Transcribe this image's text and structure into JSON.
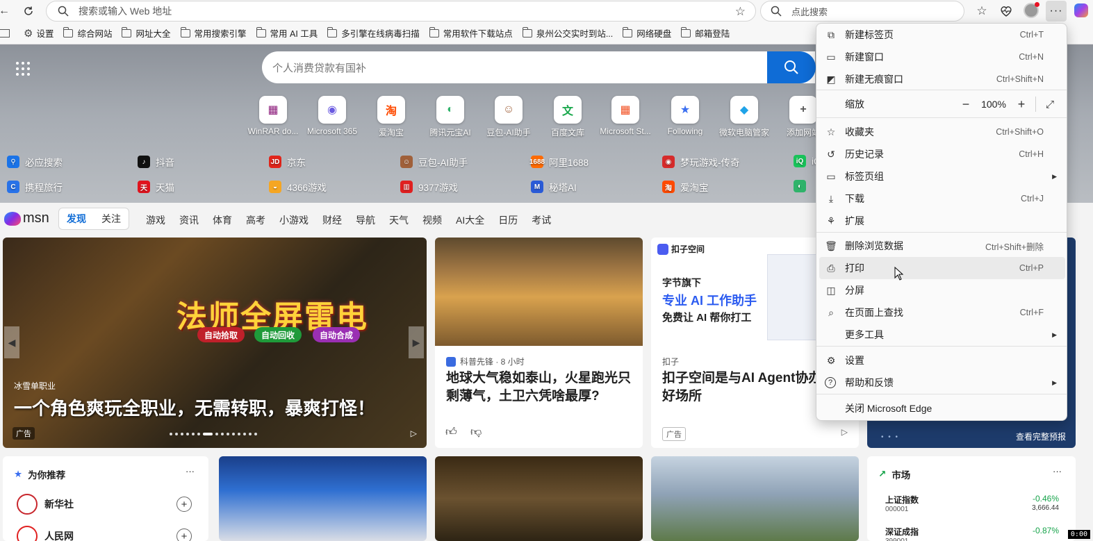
{
  "toolbar": {
    "address_placeholder": "搜索或输入 Web 地址",
    "search_placeholder": "点此搜索",
    "more_label": "···"
  },
  "favorites": [
    {
      "label": "设置",
      "icon": "gear-icon"
    },
    {
      "label": "综合网站",
      "icon": "folder-icon"
    },
    {
      "label": "网址大全",
      "icon": "folder-icon"
    },
    {
      "label": "常用搜索引擎",
      "icon": "folder-icon"
    },
    {
      "label": "常用 AI 工具",
      "icon": "folder-icon"
    },
    {
      "label": "多引擎在线病毒扫描",
      "icon": "folder-icon"
    },
    {
      "label": "常用软件下载站点",
      "icon": "folder-icon"
    },
    {
      "label": "泉州公交实时到站...",
      "icon": "folder-icon"
    },
    {
      "label": "网络硬盘",
      "icon": "folder-icon"
    },
    {
      "label": "邮箱登陆",
      "icon": "folder-icon"
    }
  ],
  "hero": {
    "search_placeholder": "个人消费贷款有国补",
    "tiles": [
      {
        "label": "WinRAR do...",
        "glyph": "▦",
        "color": "#8b1a7a"
      },
      {
        "label": "Microsoft 365",
        "glyph": "◉",
        "color": "#6a5ae0"
      },
      {
        "label": "爱淘宝",
        "glyph": "淘",
        "color": "#ff4a00"
      },
      {
        "label": "腾讯元宝AI",
        "glyph": "◐",
        "color": "#2fb36a"
      },
      {
        "label": "豆包-AI助手",
        "glyph": "☺",
        "color": "#a0603a"
      },
      {
        "label": "百度文库",
        "glyph": "文",
        "color": "#19a84c"
      },
      {
        "label": "Microsoft St...",
        "glyph": "▦",
        "color": "#f25022"
      },
      {
        "label": "Following",
        "glyph": "★",
        "color": "#3b6ff0"
      },
      {
        "label": "微软电脑管家",
        "glyph": "◆",
        "color": "#1fa3e8"
      },
      {
        "label": "添加网站",
        "glyph": "+",
        "color": "#555555"
      }
    ],
    "quick_links_row1": [
      {
        "label": "必应搜索",
        "glyph": "⚲",
        "color": "#1a73e8"
      },
      {
        "label": "抖音",
        "glyph": "♪",
        "color": "#111111"
      },
      {
        "label": "京东",
        "glyph": "JD",
        "color": "#e1251b"
      },
      {
        "label": "豆包-AI助手",
        "glyph": "☺",
        "color": "#a0603a"
      },
      {
        "label": "阿里1688",
        "glyph": "1688",
        "color": "#ff6a00"
      },
      {
        "label": "梦玩游戏-传奇",
        "glyph": "◉",
        "color": "#d62b2b"
      },
      {
        "label": "iQIYI",
        "glyph": "iQ",
        "color": "#19c35a"
      }
    ],
    "quick_links_row2": [
      {
        "label": "携程旅行",
        "glyph": "C",
        "color": "#2872e8"
      },
      {
        "label": "天猫",
        "glyph": "天",
        "color": "#e0141e"
      },
      {
        "label": "4366游戏",
        "glyph": "◒",
        "color": "#f5a623"
      },
      {
        "label": "9377游戏",
        "glyph": "▥",
        "color": "#e02020"
      },
      {
        "label": "秘塔AI",
        "glyph": "M",
        "color": "#2a5bd7"
      },
      {
        "label": "爱淘宝",
        "glyph": "淘",
        "color": "#ff4a00"
      },
      {
        "label": "",
        "glyph": "◐",
        "color": "#2fb36a"
      }
    ]
  },
  "msn": {
    "logo": "msn",
    "tabs": [
      "发现",
      "关注"
    ],
    "nav": [
      "游戏",
      "资讯",
      "体育",
      "高考",
      "小游戏",
      "财经",
      "导航",
      "天气",
      "视频",
      "AI大全",
      "日历",
      "考试"
    ]
  },
  "cards": {
    "game": {
      "big_title": "法师全屏雷电",
      "pills": [
        {
          "label": "自动拾取",
          "color": "#c0202a"
        },
        {
          "label": "自动回收",
          "color": "#1f9a3a"
        },
        {
          "label": "自动合成",
          "color": "#9a2fb3"
        }
      ],
      "sub": "冰雪单职业",
      "headline": "一个角色爽玩全职业，无需转职，暴爽打怪！",
      "ad": "广告"
    },
    "news": {
      "source": "科普先锋 · 8 小时",
      "title": "地球大气稳如泰山，火星跑光只剩薄气，土卫六凭啥最厚?",
      "like_icon": "thumbs-up-icon",
      "dislike_icon": "thumbs-down-icon"
    },
    "ad": {
      "brand": "扣子空间",
      "line1": "字节旗下",
      "line2": "专业 AI 工作助手",
      "line3": "免费让 AI 帮你打工",
      "source": "扣子",
      "title": "扣子空间是与AI Agent协办公的好场所",
      "ad": "广告"
    },
    "weather_more": "查看完整预报",
    "recommend": {
      "header": "为你推荐",
      "items": [
        {
          "label": "新华社"
        },
        {
          "label": "人民网"
        }
      ]
    },
    "market": {
      "header": "市场",
      "rows": [
        {
          "name": "上证指数",
          "code": "000001",
          "change": "-0.46%",
          "value": "3,666.44"
        },
        {
          "name": "深证成指",
          "code": "399001",
          "change": "-0.87%",
          "value": ""
        }
      ]
    },
    "time_badge": "0:00"
  },
  "menu": {
    "items": [
      {
        "label": "新建标签页",
        "shortcut": "Ctrl+T",
        "icon": "new-tab-icon"
      },
      {
        "label": "新建窗口",
        "shortcut": "Ctrl+N",
        "icon": "new-window-icon"
      },
      {
        "label": "新建无痕窗口",
        "shortcut": "Ctrl+Shift+N",
        "icon": "inprivate-icon"
      },
      {
        "label": "缩放",
        "zoom": "100%"
      },
      {
        "label": "收藏夹",
        "shortcut": "Ctrl+Shift+O",
        "icon": "favorites-icon"
      },
      {
        "label": "历史记录",
        "shortcut": "Ctrl+H",
        "icon": "history-icon"
      },
      {
        "label": "标签页组",
        "icon": "tab-groups-icon"
      },
      {
        "label": "下载",
        "shortcut": "Ctrl+J",
        "icon": "download-icon"
      },
      {
        "label": "扩展",
        "icon": "extensions-icon"
      },
      {
        "label": "删除浏览数据",
        "shortcut": "Ctrl+Shift+删除",
        "icon": "delete-icon"
      },
      {
        "label": "打印",
        "shortcut": "Ctrl+P",
        "icon": "print-icon"
      },
      {
        "label": "分屏",
        "icon": "split-screen-icon"
      },
      {
        "label": "在页面上查找",
        "shortcut": "Ctrl+F",
        "icon": "find-icon"
      },
      {
        "label": "更多工具"
      },
      {
        "label": "设置",
        "icon": "settings-icon"
      },
      {
        "label": "帮助和反馈",
        "icon": "help-icon"
      },
      {
        "label": "关闭 Microsoft Edge"
      }
    ]
  }
}
